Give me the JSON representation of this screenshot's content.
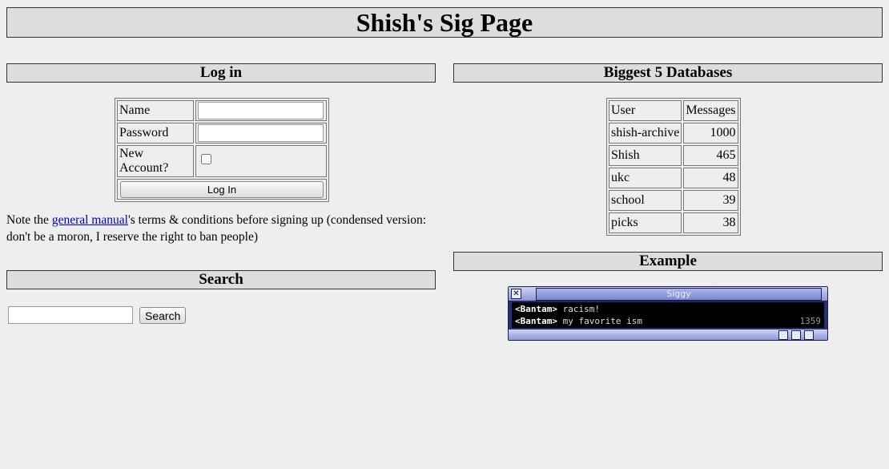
{
  "page": {
    "title": "Shish's Sig Page"
  },
  "login": {
    "heading": "Log in",
    "name_label": "Name",
    "password_label": "Password",
    "new_account_label": "New Account?",
    "button_label": "Log In",
    "name_value": "",
    "password_value": ""
  },
  "note": {
    "before": "Note the ",
    "link_text": "general manual",
    "after": "'s terms & conditions before signing up (condensed version: don't be a moron, I reserve the right to ban people)"
  },
  "search": {
    "heading": "Search",
    "input_value": "",
    "button_label": "Search"
  },
  "databases": {
    "heading": "Biggest 5 Databases",
    "col_user": "User",
    "col_messages": "Messages",
    "rows": [
      {
        "user": "shish-archive",
        "messages": "1000"
      },
      {
        "user": "Shish",
        "messages": "465"
      },
      {
        "user": "ukc",
        "messages": "48"
      },
      {
        "user": "school",
        "messages": "39"
      },
      {
        "user": "picks",
        "messages": "38"
      }
    ]
  },
  "example": {
    "heading": "Example",
    "widget_title": "Siggy",
    "close_glyph": "✕",
    "icon_close": "close-icon",
    "lines": [
      {
        "nick": "<Bantam>",
        "text": " racism!"
      },
      {
        "nick": "<Bantam>",
        "text": " my favorite ism"
      }
    ],
    "counter": "1359"
  },
  "colors": {
    "page_bg": "#eeeeee",
    "header_bg": "#dddddd",
    "link": "#0000cc",
    "widget_frame": "#2a2f72"
  }
}
